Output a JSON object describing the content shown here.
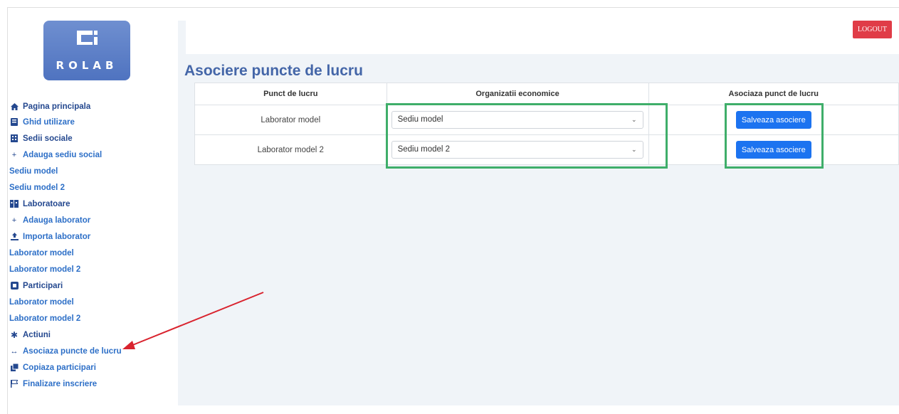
{
  "logo": {
    "text": "ROLAB"
  },
  "header": {
    "logout_label": "LOGOUT"
  },
  "sidebar": {
    "items": [
      {
        "label": "Pagina principala",
        "icon": "home-icon",
        "kind": "section"
      },
      {
        "label": "Ghid utilizare",
        "icon": "book-icon",
        "kind": "link"
      },
      {
        "label": "Sedii sociale",
        "icon": "building-icon",
        "kind": "section"
      },
      {
        "label": "Adauga sediu social",
        "icon": "plus-icon",
        "kind": "link"
      },
      {
        "label": "Sediu model",
        "icon": "",
        "kind": "link"
      },
      {
        "label": "Sediu model 2",
        "icon": "",
        "kind": "link"
      },
      {
        "label": "Laboratoare",
        "icon": "lab-icon",
        "kind": "section"
      },
      {
        "label": "Adauga laborator",
        "icon": "plus-icon",
        "kind": "link"
      },
      {
        "label": "Importa laborator",
        "icon": "upload-icon",
        "kind": "link"
      },
      {
        "label": "Laborator model",
        "icon": "",
        "kind": "link"
      },
      {
        "label": "Laborator model 2",
        "icon": "",
        "kind": "link"
      },
      {
        "label": "Participari",
        "icon": "copy-icon",
        "kind": "section"
      },
      {
        "label": "Laborator model",
        "icon": "",
        "kind": "link"
      },
      {
        "label": "Laborator model 2",
        "icon": "",
        "kind": "link"
      },
      {
        "label": "Actiuni",
        "icon": "gear-icon",
        "kind": "section"
      },
      {
        "label": "Asociaza puncte de lucru",
        "icon": "arrows-horizontal-icon",
        "kind": "link"
      },
      {
        "label": "Copiaza participari",
        "icon": "clone-icon",
        "kind": "link"
      },
      {
        "label": "Finalizare inscriere",
        "icon": "flag-icon",
        "kind": "link"
      }
    ]
  },
  "main": {
    "title": "Asociere puncte de lucru",
    "table": {
      "headers": [
        "Punct de lucru",
        "Organizatii economice",
        "Asociaza punct de lucru"
      ],
      "rows": [
        {
          "punct": "Laborator model",
          "organizatie": "Sediu model",
          "button": "Salveaza asociere"
        },
        {
          "punct": "Laborator model 2",
          "organizatie": "Sediu model 2",
          "button": "Salveaza asociere"
        }
      ]
    }
  },
  "colors": {
    "accent": "#1c73f0",
    "logout": "#e03c47",
    "highlight": "#3fae6a",
    "annotation_arrow": "#d9232e",
    "sidebar_link": "#2d6fc7"
  }
}
